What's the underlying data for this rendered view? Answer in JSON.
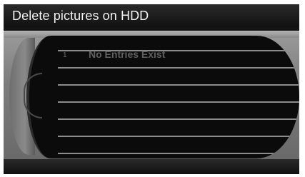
{
  "header": {
    "title": "Delete pictures on HDD"
  },
  "list": {
    "rows": [
      {
        "index": "1",
        "label": "No Entries Exist"
      }
    ]
  }
}
